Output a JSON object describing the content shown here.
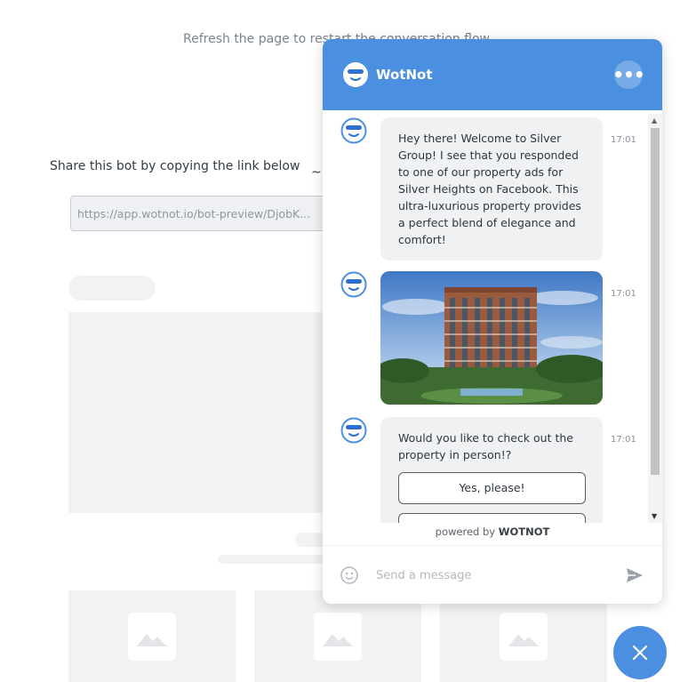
{
  "background": {
    "refresh_note": "Refresh the page to restart the conversation flow",
    "share_label": "Share this bot by copying the link below",
    "share_link": "https://app.wotnot.io/bot-preview/DjobK..."
  },
  "chat": {
    "title": "WotNot",
    "menu_label": "•••",
    "accent_color": "#4a8fe0",
    "messages": [
      {
        "text": "Hey there! Welcome to Silver Group! I see that you responded to one of our property ads for Silver Heights on Facebook. This ultra-luxurious property provides a perfect blend of elegance and comfort!",
        "time": "17:01"
      },
      {
        "image": "apartment-tower-photo",
        "time": "17:01"
      },
      {
        "text": "Would you like to check out the property in person!?",
        "time": "17:01",
        "quick_replies": [
          "Yes, please!"
        ]
      }
    ],
    "powered_prefix": "powered by",
    "powered_brand": "WOTNOT",
    "composer_placeholder": "Send a message"
  }
}
